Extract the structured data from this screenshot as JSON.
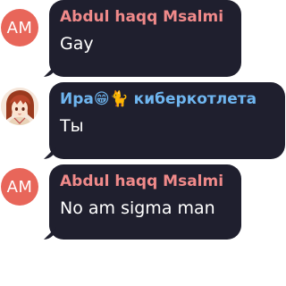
{
  "messages": [
    {
      "sender": "Abdul haqq Msalmi",
      "sender_color": "#f08a8a",
      "avatar_initials": "AM",
      "avatar_color": "#e8665a",
      "text": "Gay"
    },
    {
      "sender": "Ира😁🐈 киберкотлета",
      "sender_color": "#6fb6f0",
      "avatar_type": "illustrated-girl-portrait",
      "text": "Ты"
    },
    {
      "sender": "Abdul haqq Msalmi",
      "sender_color": "#f08a8a",
      "avatar_initials": "AM",
      "avatar_color": "#e8665a",
      "text": "No am sigma man"
    }
  ]
}
